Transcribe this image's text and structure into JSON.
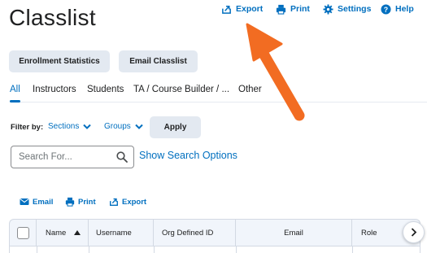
{
  "page": {
    "title": "Classlist"
  },
  "top_actions": {
    "export": {
      "label": "Export",
      "icon": "export-icon"
    },
    "print": {
      "label": "Print",
      "icon": "printer-icon"
    },
    "settings": {
      "label": "Settings",
      "icon": "gear-icon"
    },
    "help": {
      "label": "Help",
      "icon": "help-icon"
    }
  },
  "buttons": {
    "enrollment_statistics": "Enrollment Statistics",
    "email_classlist": "Email Classlist"
  },
  "tabs": [
    {
      "label": "All",
      "active": true
    },
    {
      "label": "Instructors",
      "active": false
    },
    {
      "label": "Students",
      "active": false
    },
    {
      "label": "TA / Course Builder / ...",
      "active": false
    },
    {
      "label": "Other",
      "active": false
    }
  ],
  "filter": {
    "label": "Filter by:",
    "sections": "Sections",
    "groups": "Groups",
    "apply": "Apply"
  },
  "search": {
    "placeholder": "Search For...",
    "value": "",
    "options_link": "Show Search Options"
  },
  "list_actions": {
    "email": "Email",
    "print": "Print",
    "export": "Export"
  },
  "table": {
    "columns": [
      "Name",
      "Username",
      "Org Defined ID",
      "Email",
      "Role"
    ],
    "sort_column": "Name",
    "sort_direction": "ascending"
  },
  "colors": {
    "link": "#006fbf",
    "button_bg": "#e3e9f1",
    "header_bg": "#f1f5fb",
    "callout_arrow": "#f26c22"
  }
}
